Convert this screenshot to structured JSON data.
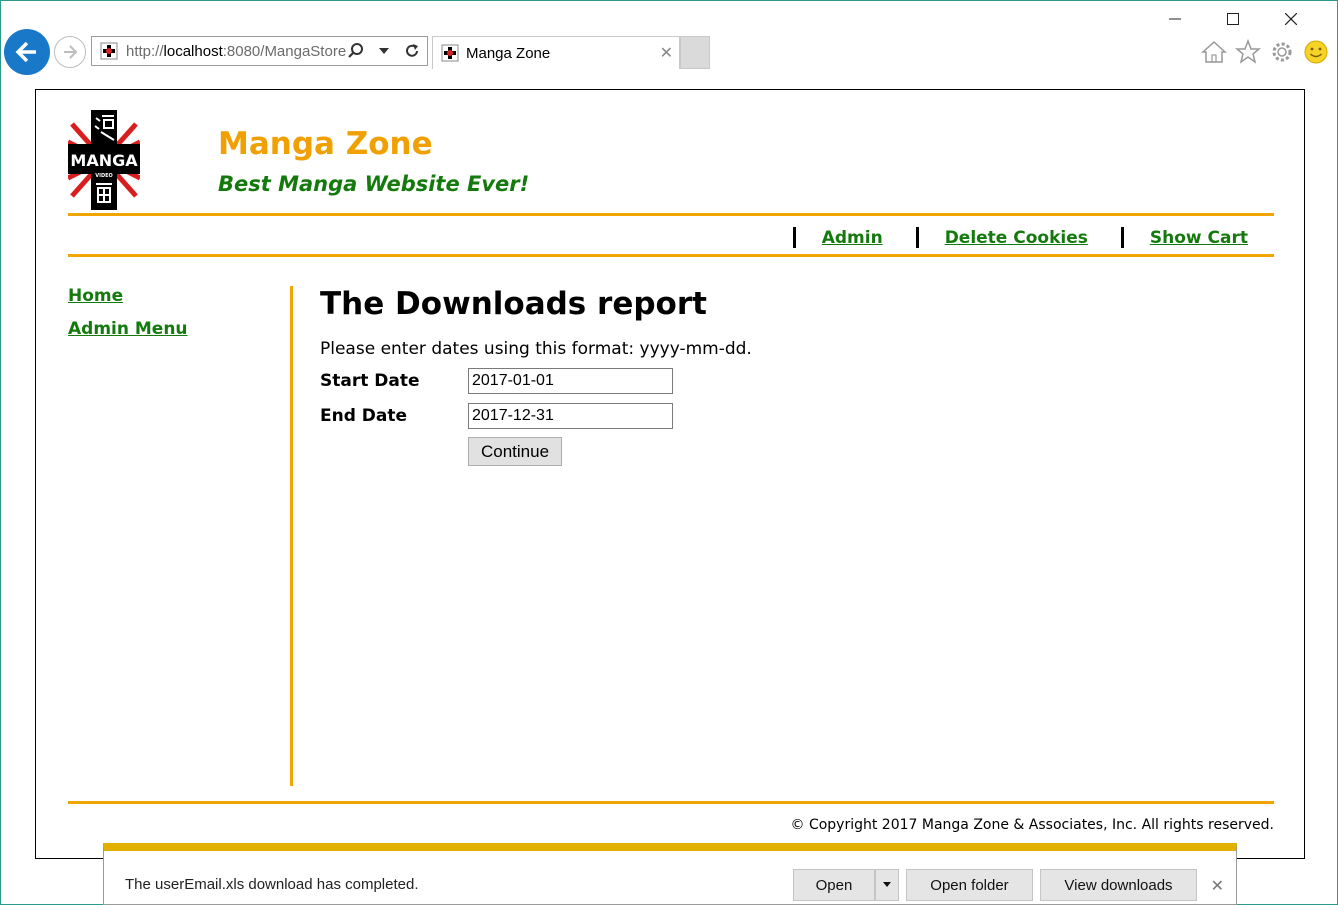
{
  "browser": {
    "url_prefix": "http://",
    "url_host": "localhost",
    "url_rest": ":8080/MangaStore",
    "tab_title": "Manga Zone",
    "window_controls": [
      "minimize",
      "maximize",
      "close"
    ],
    "toolbar_icons": [
      "home-icon",
      "favorites-star-icon",
      "settings-gear-icon",
      "feedback-smiley-icon"
    ]
  },
  "header": {
    "title": "Manga Zone",
    "tagline": "Best Manga Website Ever!",
    "logo_text": "MANGA",
    "logo_subtext": "VIDEO"
  },
  "topnav": {
    "items": [
      {
        "label": "Admin"
      },
      {
        "label": "Delete Cookies"
      },
      {
        "label": "Show Cart"
      }
    ]
  },
  "sidebar": {
    "items": [
      {
        "label": "Home"
      },
      {
        "label": "Admin Menu"
      }
    ]
  },
  "main": {
    "heading": "The Downloads report",
    "instructions": "Please enter dates using this format: yyyy-mm-dd.",
    "start_label": "Start Date",
    "start_value": "2017-01-01",
    "end_label": "End Date",
    "end_value": "2017-12-31",
    "continue_label": "Continue"
  },
  "footer": {
    "copyright": "© Copyright 2017 Manga Zone & Associates, Inc. All rights reserved."
  },
  "download_bar": {
    "message": "The userEmail.xls download has completed.",
    "open_label": "Open",
    "open_folder_label": "Open folder",
    "view_downloads_label": "View downloads"
  },
  "colors": {
    "accent_orange": "#f0a500",
    "link_green": "#157a0d",
    "browser_blue": "#1a78c8"
  }
}
